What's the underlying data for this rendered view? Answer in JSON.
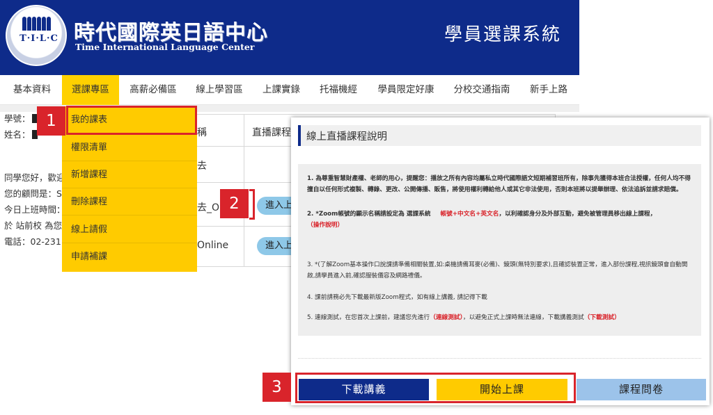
{
  "header": {
    "logo_text": "T·I·L·C",
    "brand_title": "時代國際英日語中心",
    "brand_subtitle": "Time International Language Center",
    "system_title": "學員選課系統"
  },
  "nav": {
    "items": [
      {
        "label": "基本資料"
      },
      {
        "label": "選課專區"
      },
      {
        "label": "高薪必備區"
      },
      {
        "label": "線上學習區"
      },
      {
        "label": "上課實錄"
      },
      {
        "label": "托福機經"
      },
      {
        "label": "學員限定好康"
      },
      {
        "label": "分校交通指南"
      },
      {
        "label": "新手上路"
      }
    ]
  },
  "dropdown": {
    "items": [
      {
        "label": "我的課表"
      },
      {
        "label": "權限清單"
      },
      {
        "label": "新增課程"
      },
      {
        "label": "刪除課程"
      },
      {
        "label": "線上請假"
      },
      {
        "label": "申請補課"
      }
    ]
  },
  "student_info": {
    "id_label": "學號：",
    "name_label": "姓名：",
    "greeting": "同學您好，歡迎",
    "advisor": "您的顧問是：S",
    "today_time": "今日上班時間：",
    "location": "於 站前校 為您",
    "phone": "電話：02-2311"
  },
  "table": {
    "header_text": "直播課程",
    "header_partial": "稱",
    "row1_partial": "去",
    "row2_partial": "去_On",
    "row3_partial": "Online",
    "enter_label": "進入上課"
  },
  "badges": [
    "1",
    "2",
    "3"
  ],
  "modal": {
    "title": "線上直播課程說明",
    "p1": "1. 為尊重智慧財產權、老師的用心，提醒您：播放之所有內容均屬私立時代國際語文短期補習班所有，除事先獲得本班合法授權，任何人均不得擅自以任何形式複製、轉錄、更改、公開傳播、販售，將使用權利轉給他人或其它非法使用，否則本班將以提舉辦理、依法追訴並請求賠償。",
    "p2_a": "2. *Zoom帳號的顯示名稱請設定為 選課系統",
    "p2_red": "帳號+中文名+英文名",
    "p2_b": "，以利確認身分及外部互動，避免被管理員移出線上課程，",
    "p2_link": "（操作說明）",
    "p3": "3. *(了解Zoom基本操作口說課請準備相關裝置,如:桌機請備耳麥(必備)、鏡頭(無特別要求),且確認裝置正常，進入部份課程,視訊鏡頭會自動開啟,請學員進入前,確認服裝儀容及網路禮儀。",
    "p4": "4. 課前請務必先下載最新版Zoom程式，如有線上講義, 請記得下載",
    "p5_a": "5. 連線測試，在您首次上課前，建議您先進行",
    "p5_link1": "（連線測試）",
    "p5_b": "，以避免正式上課時無法連線，下載講義測試",
    "p5_link2": "（下載測試）",
    "buttons": {
      "download": "下載講義",
      "start": "開始上課",
      "survey": "課程問卷"
    }
  },
  "colors": {
    "header_blue": "#0e2b8a",
    "accent_yellow": "#ffcb00",
    "highlight_red": "#d9242b",
    "pill_blue": "#8ec8e8",
    "survey_blue": "#9cc3ea"
  }
}
